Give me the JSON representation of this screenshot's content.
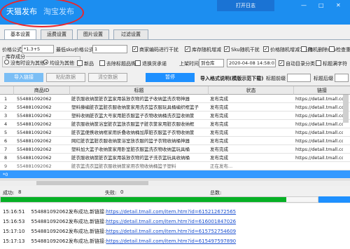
{
  "tabs": {
    "main": [
      "天猫发布",
      "淘宝发布"
    ],
    "log_button": "打开日志",
    "window_controls": [
      "—",
      "□",
      "✕"
    ]
  },
  "subtabs": [
    "基本设置",
    "运费设置",
    "图片设置",
    "过滤设置"
  ],
  "settings": {
    "price_formula_label": "价格公式",
    "price_formula_value": "*1.3+5",
    "min_sku_label": "最低sku价格公式",
    "min_sku_value": "1",
    "checks": [
      {
        "label": "商家编码进行干扰",
        "checked": true
      },
      {
        "label": "库存随机增减",
        "checked": true
      },
      {
        "label": "Sku随机干扰",
        "checked": true
      },
      {
        "label": "价格随机增减1元内",
        "checked": true
      },
      {
        "label": "随机删除sku",
        "checked": false
      },
      {
        "label": "检查重",
        "checked": false
      }
    ],
    "stock_group_label": "库存成分",
    "radios": [
      {
        "label": "没有时设为其他",
        "selected": false
      },
      {
        "label": "均设为其他",
        "selected": true
      }
    ],
    "row2_checks": [
      {
        "label": "新品",
        "checked": false
      },
      {
        "label": "去除标题品牌词",
        "checked": false
      },
      {
        "label": "退换货承诺",
        "checked": false
      }
    ],
    "shelf_label": "上架时间",
    "shelf_select": "到仓库",
    "datetime": "2020-04-08 14:58:01",
    "auto_category": {
      "label": "自动目录分类",
      "checked": true
    },
    "title_full": {
      "label": "标题满字符",
      "checked": false
    }
  },
  "actions": {
    "import_btn": "导入链接",
    "paste_btn": "粘贴数据",
    "clear_btn": "清空数据",
    "pause_btn": "暂停",
    "import_format_link": "导入格式说明(模版示范下载)",
    "title_prefix_label": "标题前缀",
    "title_suffix_label": "标题后缀"
  },
  "table": {
    "columns": [
      "",
      "商品ID",
      "标题",
      "状态",
      "链接"
    ],
    "rows": [
      {
        "num": "1",
        "id": "554881092062",
        "title": "脏衣服收纳筐脏衣篮家用装放衣物的篮子收纳篮洗衣物神器",
        "status": "发布完成",
        "link": "https://detail.tmall.com/ite"
      },
      {
        "num": "2",
        "id": "554881092062",
        "title": "塑料藤编脏衣篮脏衣服收纳筐家用洗衣篮衣服玩具桶编织框篮子",
        "status": "发布完成",
        "link": "https://detail.tmall.com/ite"
      },
      {
        "num": "3",
        "id": "554881092062",
        "title": "塑料收纳脏衣篮大号家用脏衣服篮子衣物收纳桶洗衣篮收纳筐",
        "status": "发布完成",
        "link": "https://detail.tmall.com/ite"
      },
      {
        "num": "4",
        "id": "554881092062",
        "title": "脏衣服收纳筐浴室脏衣篮放衣服篮子脏衣筐家用脏衣服收纳框",
        "status": "发布完成",
        "link": "https://detail.tmall.com/ite"
      },
      {
        "num": "5",
        "id": "554881092062",
        "title": "脏衣篮便携收纳框家用折叠收纳桶加厚脏衣服篮子衣物收纳筐",
        "status": "发布完成",
        "link": "https://detail.tmall.com/ite"
      },
      {
        "num": "6",
        "id": "554881092062",
        "title": "网红脏衣篮脏衣服收纳筐浴室放衣服的篮子衣物收纳桶神器",
        "status": "发布完成",
        "link": "https://detail.tmall.com/ite"
      },
      {
        "num": "7",
        "id": "554881092062",
        "title": "塑料加大篮子收纳筐家用卧室脏衣服篮洗衣物收纳篮玩具桶",
        "status": "发布完成",
        "link": "https://detail.tmall.com/ite"
      },
      {
        "num": "8",
        "id": "554881092062",
        "title": "脏衣服收纳筐脏衣篮家用装放衣物的篮子洗衣篮玩具收纳桶",
        "status": "发布完成",
        "link": "https://detail.tmall.com/ite"
      },
      {
        "num": "9",
        "id": "554881092062",
        "title": "脏衣篮洗衣篮脏衣服收纳筐家用衣物收纳桶篮子塑料",
        "status": "正在发布...",
        "link": ""
      }
    ],
    "new_row_marker": "*0"
  },
  "status": {
    "success_label": "成功:",
    "success_value": "8",
    "fail_label": "失败:",
    "fail_value": "0",
    "total_label": "总数:"
  },
  "progress": 0.9,
  "logs": [
    {
      "time": "15:16:51",
      "text": "554881092062发布成功,新链接:",
      "url": "https://detail.tmall.com/item.htm?id=615212672565"
    },
    {
      "time": "15:16:53",
      "text": "554881092062发布成功,新链接:",
      "url": "https://detail.tmall.com/item.htm?id=616001847026"
    },
    {
      "time": "15:17:10",
      "text": "554881092062发布成功,新链接:",
      "url": "https://detail.tmall.com/item.htm?id=615752754609"
    },
    {
      "time": "15:17:13",
      "text": "554881092062发布成功,新链接:",
      "url": "https://detail.tmall.com/item.htm?id=615497597890"
    }
  ]
}
